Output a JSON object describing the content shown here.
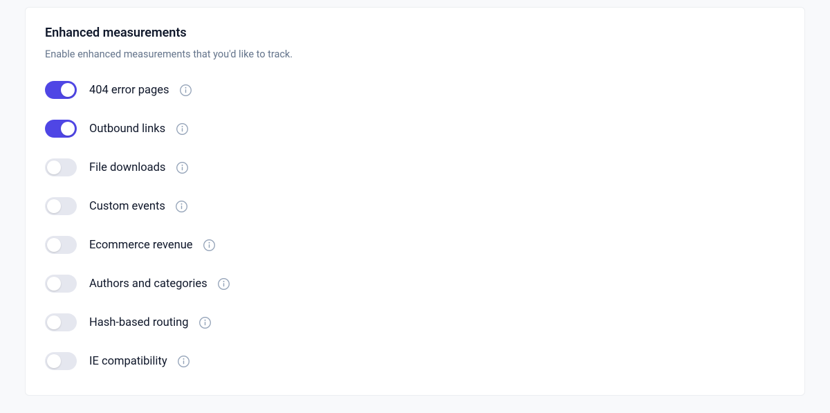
{
  "header": {
    "title": "Enhanced measurements",
    "subtitle": "Enable enhanced measurements that you'd like to track."
  },
  "measurements": [
    {
      "id": "404-error-pages",
      "label": "404 error pages",
      "enabled": true
    },
    {
      "id": "outbound-links",
      "label": "Outbound links",
      "enabled": true
    },
    {
      "id": "file-downloads",
      "label": "File downloads",
      "enabled": false
    },
    {
      "id": "custom-events",
      "label": "Custom events",
      "enabled": false
    },
    {
      "id": "ecommerce-revenue",
      "label": "Ecommerce revenue",
      "enabled": false
    },
    {
      "id": "authors-and-categories",
      "label": "Authors and categories",
      "enabled": false
    },
    {
      "id": "hash-based-routing",
      "label": "Hash-based routing",
      "enabled": false
    },
    {
      "id": "ie-compatibility",
      "label": "IE compatibility",
      "enabled": false
    }
  ],
  "colors": {
    "accent": "#4f46e5",
    "toggle_off_bg": "#e5e7ef",
    "text": "#0f172a",
    "muted": "#64748b",
    "border": "#eceef1",
    "info_icon": "#94a3b8"
  }
}
